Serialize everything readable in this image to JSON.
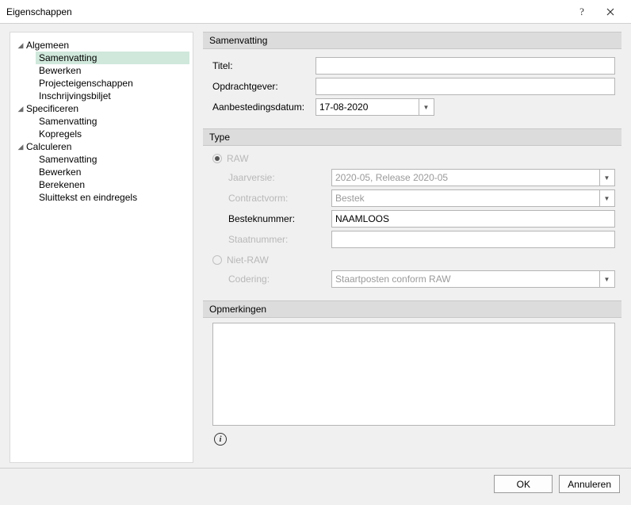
{
  "window": {
    "title": "Eigenschappen"
  },
  "tree": {
    "groups": [
      {
        "label": "Algemeen",
        "items": [
          "Samenvatting",
          "Bewerken",
          "Projecteigenschappen",
          "Inschrijvingsbiljet"
        ],
        "selectedIndex": 0
      },
      {
        "label": "Specificeren",
        "items": [
          "Samenvatting",
          "Kopregels"
        ]
      },
      {
        "label": "Calculeren",
        "items": [
          "Samenvatting",
          "Bewerken",
          "Berekenen",
          "Sluittekst en eindregels"
        ]
      }
    ]
  },
  "summary": {
    "header": "Samenvatting",
    "titel_label": "Titel:",
    "titel_value": "",
    "opdrachtgever_label": "Opdrachtgever:",
    "opdrachtgever_value": "",
    "aanbestedingsdatum_label": "Aanbestedingsdatum:",
    "aanbestedingsdatum_value": "17-08-2020"
  },
  "type": {
    "header": "Type",
    "raw_label": "RAW",
    "nietraw_label": "Niet-RAW",
    "jaarversie_label": "Jaarversie:",
    "jaarversie_value": "2020-05, Release 2020-05",
    "contractvorm_label": "Contractvorm:",
    "contractvorm_value": "Bestek",
    "besteknummer_label": "Besteknummer:",
    "besteknummer_value": "NAAMLOOS",
    "staatnummer_label": "Staatnummer:",
    "staatnummer_value": "",
    "codering_label": "Codering:",
    "codering_value": "Staartposten conform RAW"
  },
  "opmerkingen": {
    "header": "Opmerkingen",
    "value": ""
  },
  "footer": {
    "ok": "OK",
    "cancel": "Annuleren"
  }
}
